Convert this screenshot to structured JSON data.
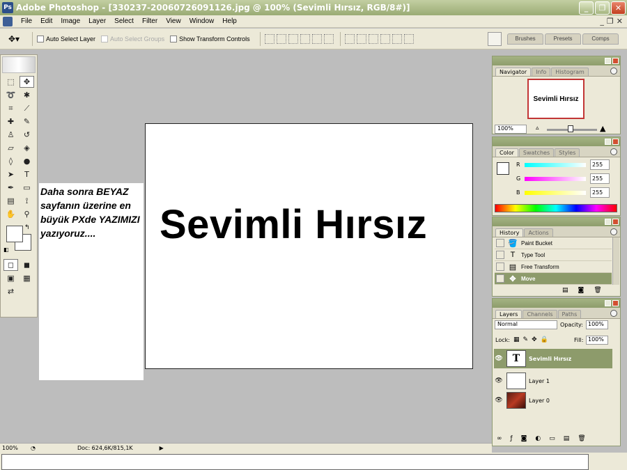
{
  "window": {
    "title": "Adobe Photoshop - [330237-20060726091126.jpg @ 100% (Sevimli Hırsız, RGB/8#)]"
  },
  "menu": [
    "File",
    "Edit",
    "Image",
    "Layer",
    "Select",
    "Filter",
    "View",
    "Window",
    "Help"
  ],
  "options": {
    "auto_select_layer": "Auto Select Layer",
    "auto_select_groups": "Auto Select Groups",
    "show_transform": "Show Transform Controls",
    "well_tabs": [
      "Brushes",
      "Presets",
      "Comps"
    ]
  },
  "canvas": {
    "text": "Sevimli Hırsız"
  },
  "note": {
    "text": "Daha sonra BEYAZ sayfanın üzerine en büyük PXde YAZIMIZI yazıyoruz...."
  },
  "navigator": {
    "tabs": [
      "Navigator",
      "Info",
      "Histogram"
    ],
    "thumb_text": "Sevimli Hırsız",
    "zoom": "100%"
  },
  "color": {
    "tabs": [
      "Color",
      "Swatches",
      "Styles"
    ],
    "channels": [
      {
        "label": "R",
        "value": "255",
        "gradient": "linear-gradient(90deg,#00ffff,#ffffff)"
      },
      {
        "label": "G",
        "value": "255",
        "gradient": "linear-gradient(90deg,#ff00ff,#ffffff)"
      },
      {
        "label": "B",
        "value": "255",
        "gradient": "linear-gradient(90deg,#ffff00,#ffffff)"
      }
    ]
  },
  "history": {
    "tabs": [
      "History",
      "Actions"
    ],
    "items": [
      {
        "label": "Paint Bucket",
        "icon": "🪣"
      },
      {
        "label": "Type Tool",
        "icon": "T"
      },
      {
        "label": "Free Transform",
        "icon": "▤"
      },
      {
        "label": "Move",
        "icon": "✥"
      }
    ]
  },
  "layers": {
    "tabs": [
      "Layers",
      "Channels",
      "Paths"
    ],
    "blend_mode": "Normal",
    "opacity_label": "Opacity:",
    "opacity": "100%",
    "lock_label": "Lock:",
    "fill_label": "Fill:",
    "fill": "100%",
    "items": [
      {
        "name": "Sevimli Hırsız",
        "thumb": "T"
      },
      {
        "name": "Layer 1",
        "thumb": ""
      },
      {
        "name": "Layer 0",
        "thumb": ""
      }
    ]
  },
  "status": {
    "zoom": "100%",
    "doc": "Doc: 624,6K/815,1K"
  },
  "colors": {
    "accent": "#8d9b6b",
    "titlebar": "#9aab74"
  }
}
